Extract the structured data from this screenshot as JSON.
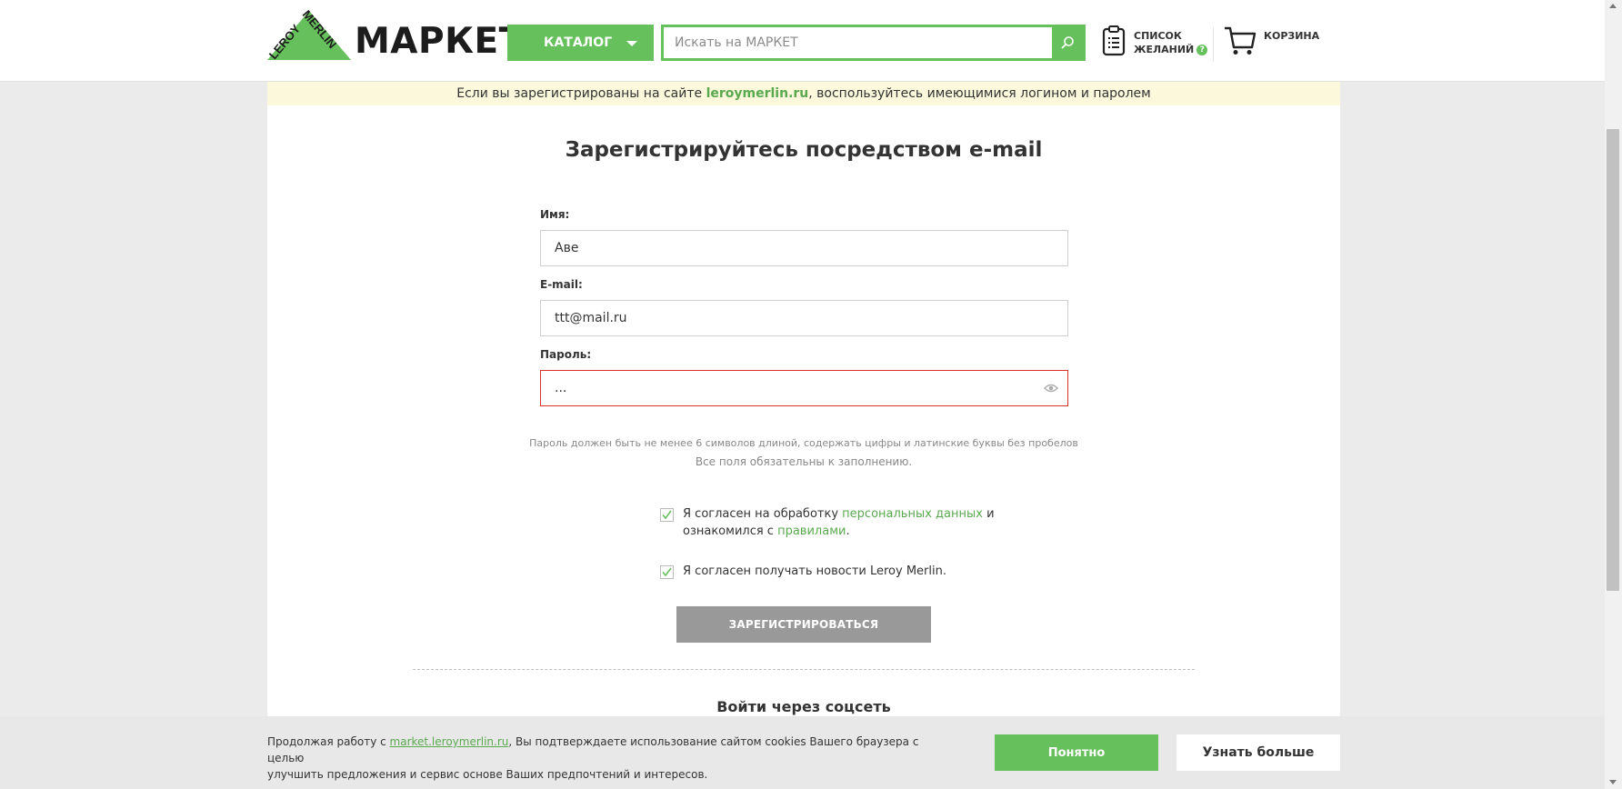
{
  "header": {
    "logo_brand": "LEROY MERLIN",
    "logo_word": "МАРКЕТ",
    "catalog_label": "КАТАЛОГ",
    "search_placeholder": "Искать на МАРКЕТ",
    "wishlist_line1": "СПИСОК",
    "wishlist_line2": "ЖЕЛАНИЙ",
    "wishlist_help": "?",
    "cart_label": "КОРЗИНА"
  },
  "notice": {
    "before": "Если вы зарегистрированы на сайте ",
    "link": "leroymerlin.ru",
    "after": ", воспользуйтесь имеющимися логином и паролем"
  },
  "form": {
    "title": "Зарегистрируйтесь посредством e-mail",
    "name_label": "Имя:",
    "name_value": "Аве",
    "email_label": "E-mail:",
    "email_value": "ttt@mail.ru",
    "password_label": "Пароль:",
    "password_value": "...",
    "password_hint": "Пароль должен быть не менее 6 символов длиной, содержать цифры и латинские буквы без пробелов",
    "required_hint": "Все поля обязательны к заполнению.",
    "consent1_before": "Я согласен на обработку ",
    "consent1_link": "персональных данных",
    "consent1_mid": " и",
    "consent1_line2_before": "ознакомился с ",
    "consent1_link2": "правилами",
    "consent1_after": ".",
    "consent1_checked": true,
    "consent2": "Я согласен получать новости Leroy Merlin.",
    "consent2_checked": true,
    "register_label": "ЗАРЕГИСТРИРОВАТЬСЯ",
    "social_title": "Войти через соцсеть"
  },
  "cookie": {
    "before": "Продолжая работу с ",
    "link": "market.leroymerlin.ru",
    "after": ", Вы подтверждаете использование сайтом cookies Вашего браузера с целью",
    "line2": "улучшить предложения и сервис  основе Ваших предпочтений и интересов.",
    "ok_label": "Понятно",
    "more_label": "Узнать больше"
  },
  "colors": {
    "brand_green": "#66c05b",
    "link_green": "#5aa94f",
    "error_red": "#d9342b",
    "notice_bg": "#fbf8dc"
  }
}
